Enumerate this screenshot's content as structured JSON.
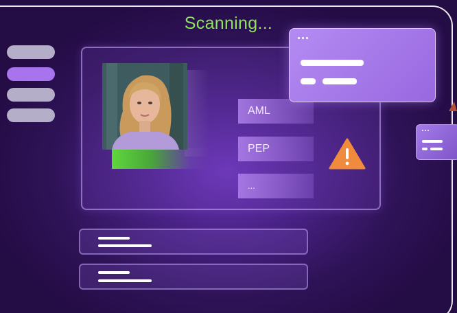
{
  "status": {
    "text": "Scanning..."
  },
  "checks": [
    {
      "label": "AML"
    },
    {
      "label": "PEP"
    },
    {
      "label": "..."
    }
  ],
  "warning": {
    "icon": "warning-triangle-icon",
    "color": "#f08a3c"
  },
  "colors": {
    "status_green": "#8fe35c",
    "accent_purple": "#a774ee",
    "sidebar_inactive": "#b5aec8",
    "progress_green": "#5fd63c"
  }
}
